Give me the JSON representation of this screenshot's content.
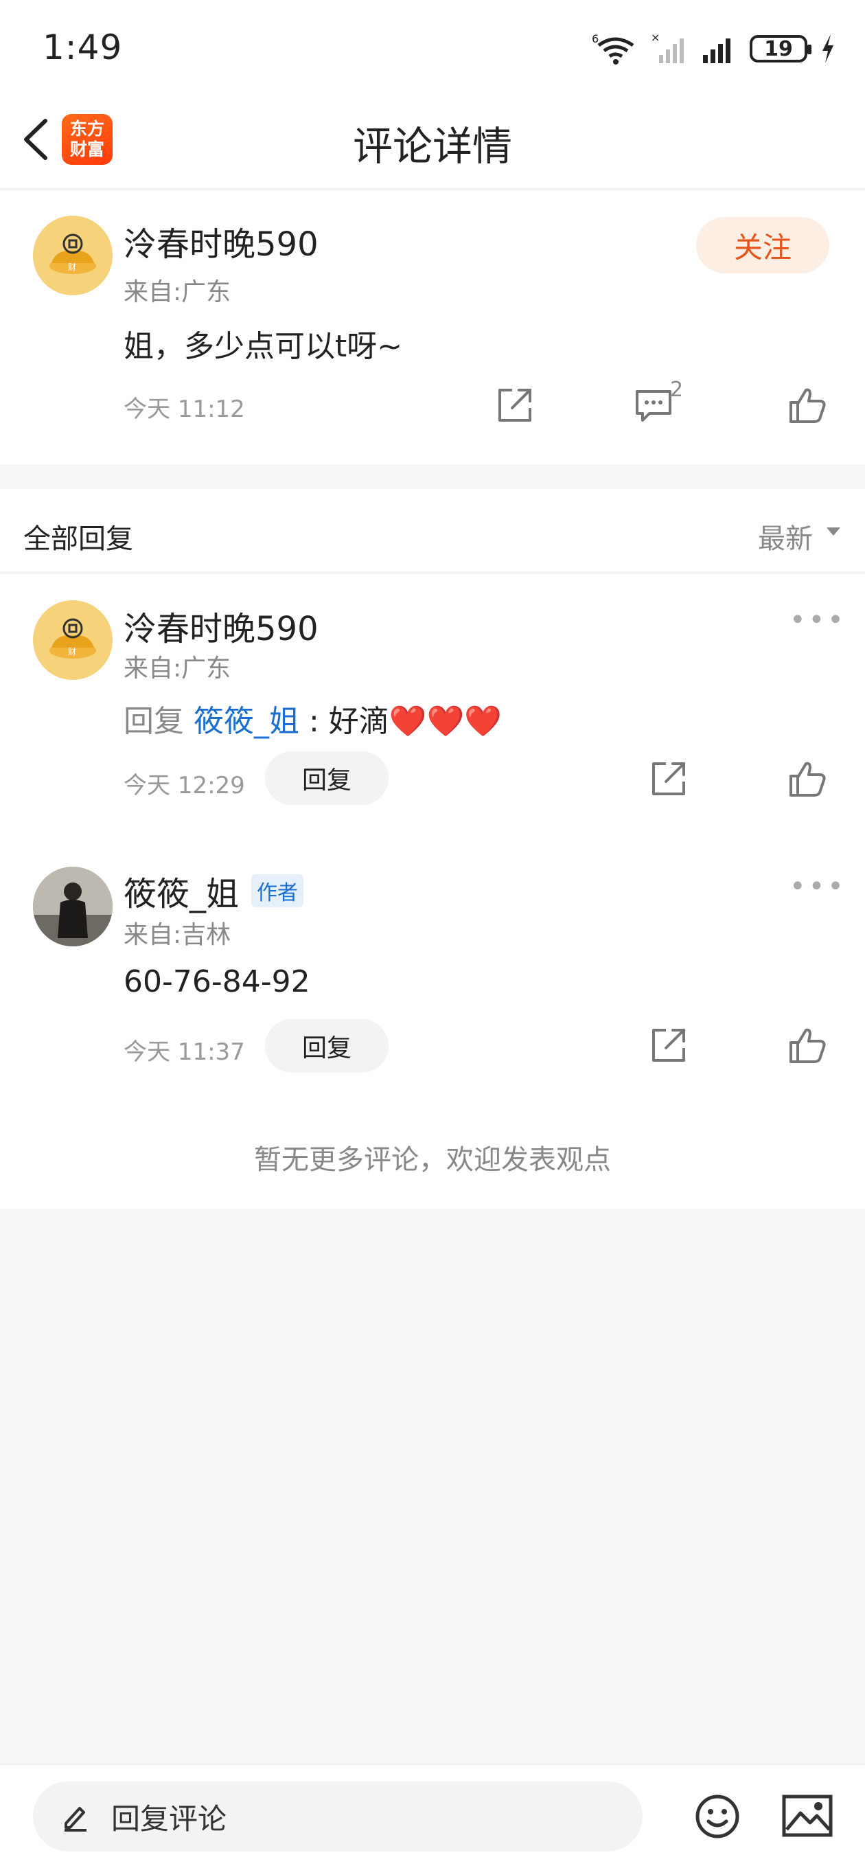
{
  "status_bar": {
    "time": "1:49",
    "network_label": "6",
    "battery": "19"
  },
  "header": {
    "logo_line1": "东方",
    "logo_line2": "财富",
    "title": "评论详情"
  },
  "main_comment": {
    "username": "泠春时晚590",
    "from": "来自:广东",
    "content": "姐，多少点可以t呀~",
    "time": "今天 11:12",
    "follow_label": "关注",
    "reply_count": "2",
    "avatar_text": "财"
  },
  "replies_section": {
    "title": "全部回复",
    "sort_label": "最新",
    "items": [
      {
        "username": "泠春时晚590",
        "from": "来自:广东",
        "reply_prefix": "回复",
        "mention": "筱筱_姐",
        "separator": " : ",
        "content": "好滴❤️❤️❤️",
        "time": "今天 12:29",
        "reply_label": "回复",
        "more": "•••",
        "avatar_text": "财"
      },
      {
        "username": "筱筱_姐",
        "author_tag": "作者",
        "from": "来自:吉林",
        "content": "60-76-84-92",
        "time": "今天 11:37",
        "reply_label": "回复",
        "more": "•••"
      }
    ],
    "no_more_text": "暂无更多评论，欢迎发表观点"
  },
  "bottom_bar": {
    "input_placeholder": "回复评论"
  },
  "colors": {
    "brand": "#ff4a0f",
    "follow_text": "#e6541a",
    "follow_bg": "#fdeee4",
    "mention": "#1a6fd0"
  },
  "icons": [
    "back-icon",
    "wifi-icon",
    "signal-icon",
    "battery-icon",
    "charging-icon",
    "share-icon",
    "comment-icon",
    "like-icon",
    "edit-icon",
    "emoji-icon",
    "image-icon",
    "more-icon",
    "sort-caret-icon"
  ]
}
